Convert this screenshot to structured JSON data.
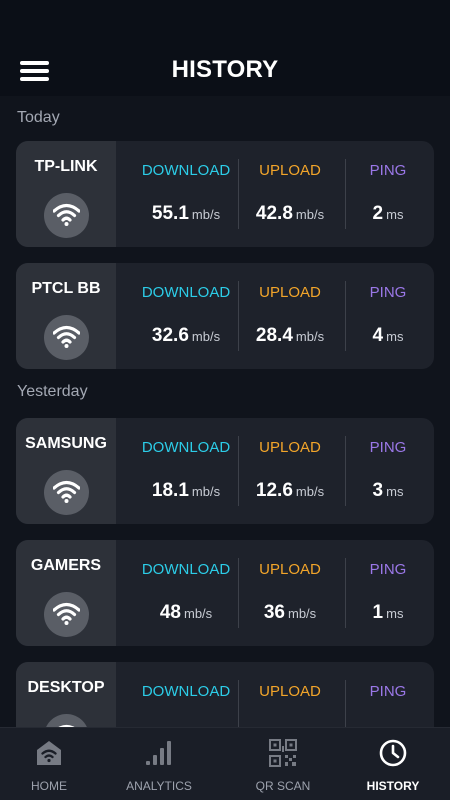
{
  "header": {
    "title": "HISTORY"
  },
  "sections": [
    {
      "label": "Today"
    },
    {
      "label": "Yesterday"
    }
  ],
  "metric_labels": {
    "download": "DOWNLOAD",
    "upload": "UPLOAD",
    "ping": "PING"
  },
  "units": {
    "speed": "mb/s",
    "ping": "ms"
  },
  "colors": {
    "download": "#2ccde8",
    "upload": "#f2a52a",
    "ping": "#9b78e8",
    "background": "#10141c",
    "card": "#1e222b"
  },
  "records": [
    {
      "network": "TP-LINK",
      "icon": "wifi-icon",
      "download": "55.1",
      "upload": "42.8",
      "ping": "2"
    },
    {
      "network": "PTCL BB",
      "icon": "wifi-icon",
      "download": "32.6",
      "upload": "28.4",
      "ping": "4"
    },
    {
      "network": "SAMSUNG",
      "icon": "wifi-icon",
      "download": "18.1",
      "upload": "12.6",
      "ping": "3"
    },
    {
      "network": "GAMERS",
      "icon": "wifi-icon",
      "download": "48",
      "upload": "36",
      "ping": "1"
    },
    {
      "network": "DESKTOP",
      "icon": "wifi-icon",
      "download": "",
      "upload": "",
      "ping": ""
    }
  ],
  "nav": {
    "items": [
      {
        "label": "HOME",
        "icon": "home-wifi-icon"
      },
      {
        "label": "ANALYTICS",
        "icon": "signal-bars-icon"
      },
      {
        "label": "QR SCAN",
        "icon": "qr-code-icon"
      },
      {
        "label": "HISTORY",
        "icon": "clock-icon",
        "active": true
      }
    ]
  }
}
